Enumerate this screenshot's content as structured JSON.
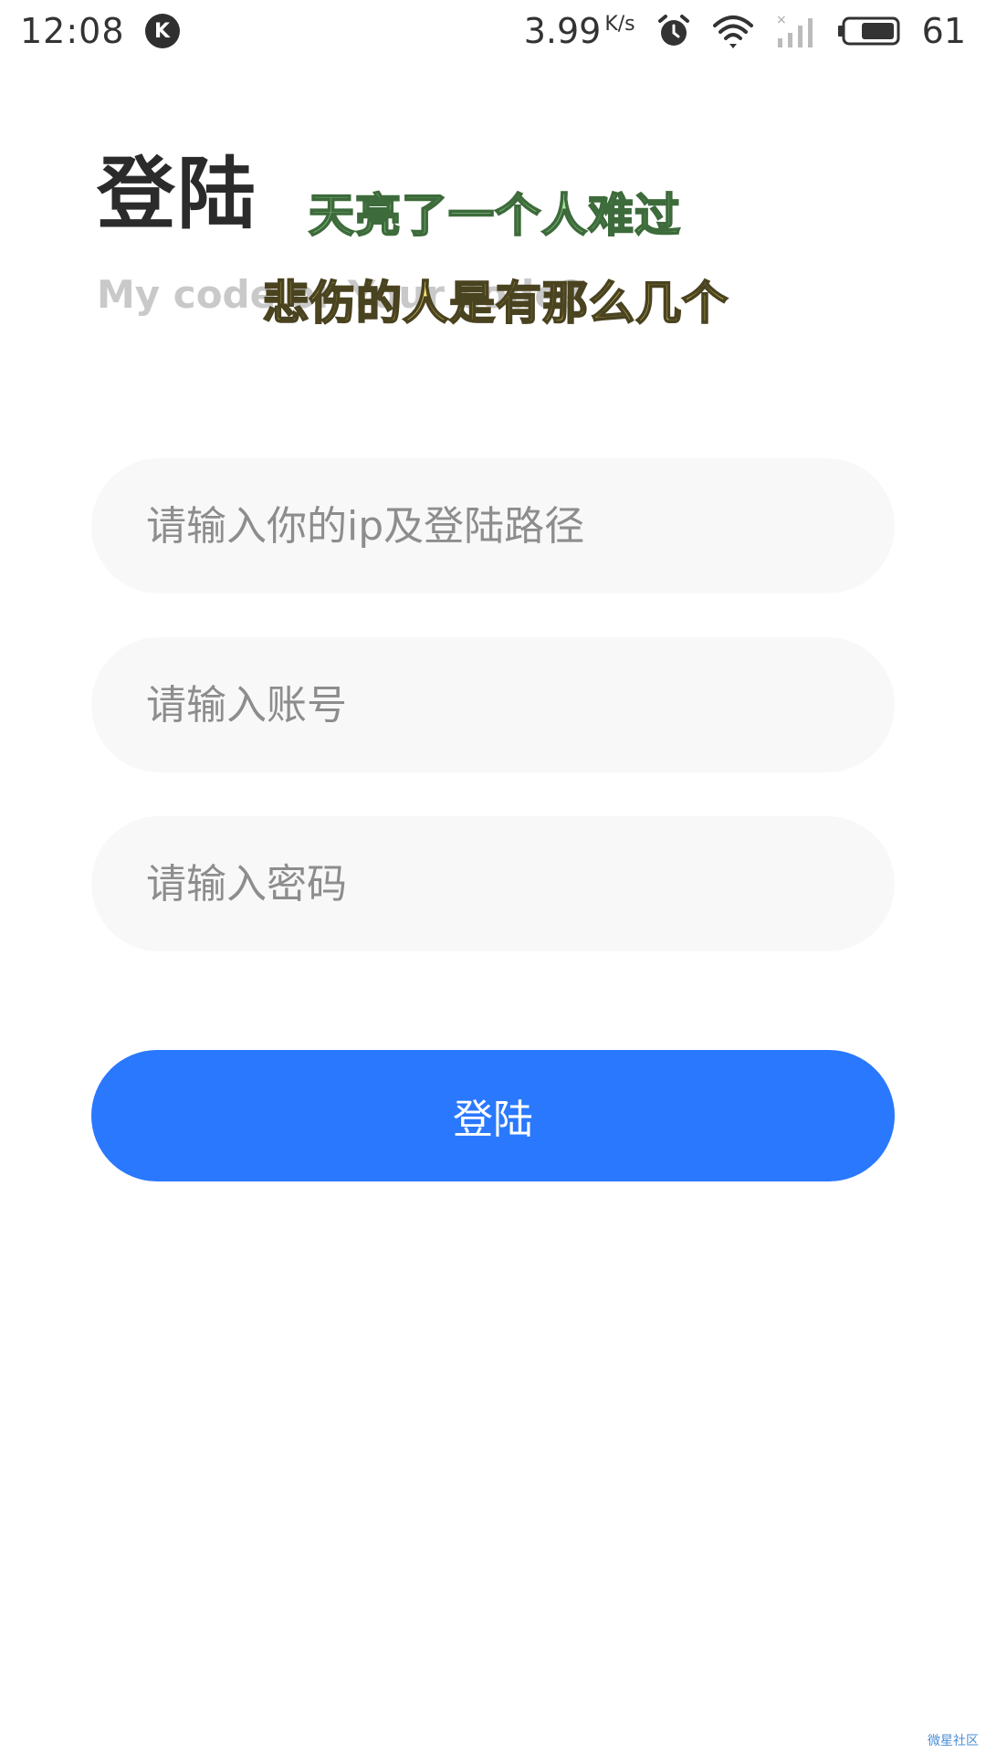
{
  "status_bar": {
    "time": "12:08",
    "network_speed": "3.99",
    "network_speed_unit": "K/s",
    "battery_percent": "61",
    "icons": [
      "k-app-icon",
      "alarm-icon",
      "wifi-icon",
      "cellular-signal-icon",
      "battery-icon"
    ]
  },
  "header": {
    "title": "登陆",
    "subtitle": "My code or Your code?"
  },
  "overlay_text": {
    "line1": "天亮了一个人难过",
    "line2": "悲伤的人是有那么几个"
  },
  "form": {
    "server_placeholder": "请输入你的ip及登陆路径",
    "account_placeholder": "请输入账号",
    "password_placeholder": "请输入密码",
    "login_label": "登陆"
  },
  "colors": {
    "primary": "#2a78fe",
    "field_background": "#f8f8f8",
    "title": "#2b2b2b",
    "subtitle": "#c9c9c9"
  },
  "watermark": "微星社区"
}
